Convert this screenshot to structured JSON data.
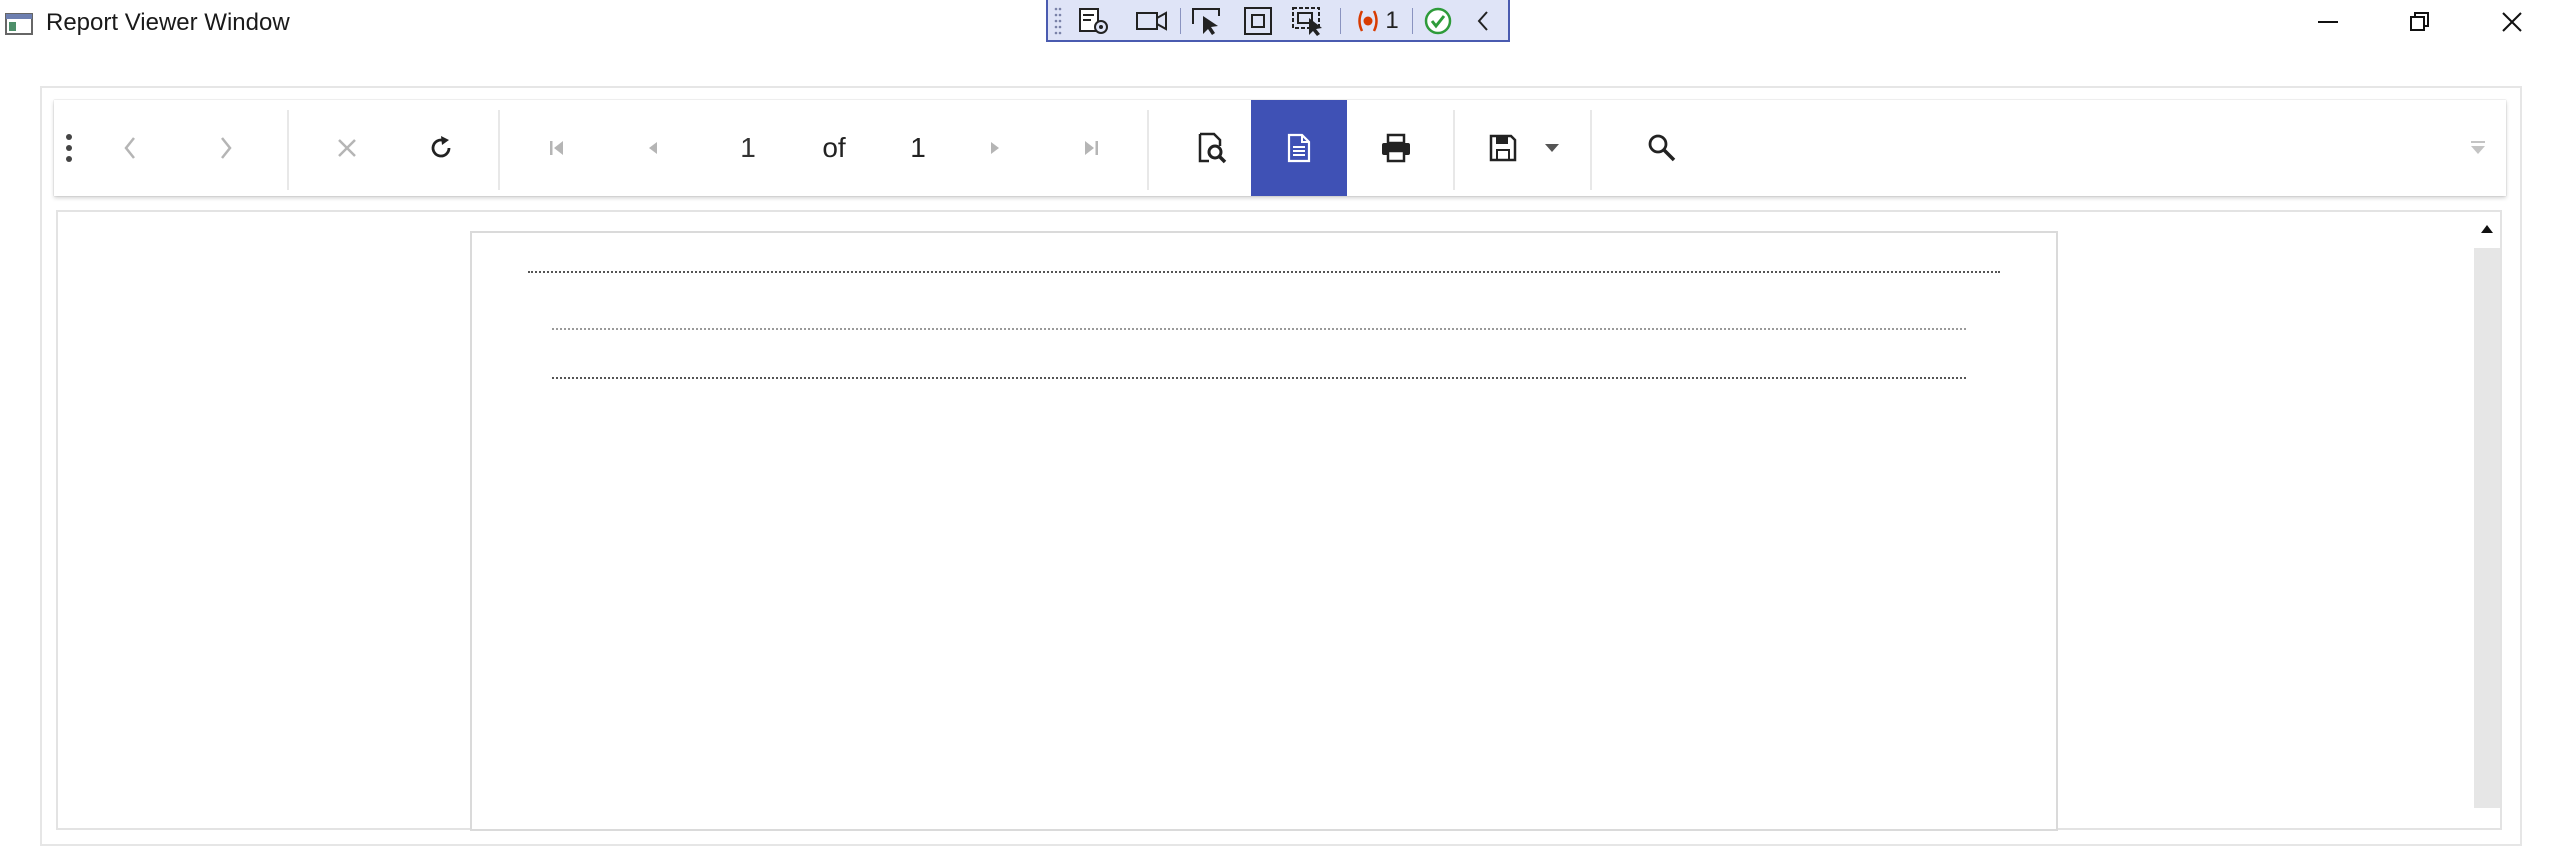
{
  "window": {
    "title": "Report Viewer Window",
    "icons": {
      "app": "app-window-icon",
      "minimize": "minimize-icon",
      "restore": "restore-icon",
      "close": "close-icon"
    }
  },
  "debug_toolbar": {
    "icons": [
      "live-visual-tree-icon",
      "record-icon",
      "select-element-icon",
      "display-layout-adorners-icon",
      "track-focus-icon",
      "binding-failures-icon",
      "accessibility-check-icon",
      "collapse-chevron-icon"
    ],
    "binding_failures_count": "1"
  },
  "toolbar": {
    "page": {
      "current": "1",
      "of_label": "of",
      "total": "1"
    },
    "icons": [
      "overflow-dots-icon",
      "back-icon",
      "forward-icon",
      "stop-icon",
      "refresh-icon",
      "first-page-icon",
      "previous-page-icon",
      "next-page-icon",
      "last-page-icon",
      "page-setup-icon",
      "print-layout-icon",
      "print-icon",
      "save-icon",
      "save-dropdown-icon",
      "search-icon",
      "parameters-toggle-icon"
    ],
    "active_button": "print-layout",
    "accent_color": "#3f51b5"
  },
  "colors": {
    "debug_bar_border": "#4a5bb0",
    "debug_bar_bg": "#dfe4f7",
    "binding_failure": "#d83b01",
    "check_green": "#2e9b3a"
  }
}
